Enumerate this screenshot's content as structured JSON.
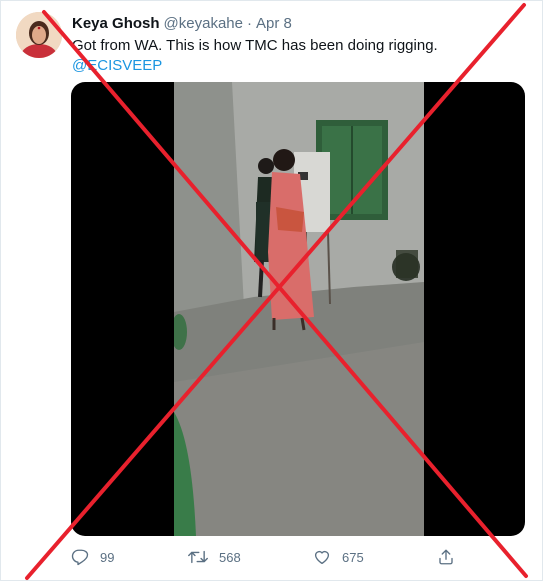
{
  "tweet": {
    "author": {
      "display_name": "Keya Ghosh",
      "handle": "@keyakahe"
    },
    "separator": "·",
    "date": "Apr 8",
    "text": "Got from WA. This is how TMC has been doing rigging.",
    "mention": "@ECISVEEP",
    "media": {
      "type": "video"
    },
    "actions": {
      "reply": {
        "icon": "reply-icon",
        "count": "99"
      },
      "retweet": {
        "icon": "retweet-icon",
        "count": "568"
      },
      "like": {
        "icon": "heart-icon",
        "count": "675"
      },
      "share": {
        "icon": "share-icon"
      }
    }
  },
  "overlay": {
    "mark": "cross",
    "color": "#e8212d"
  }
}
